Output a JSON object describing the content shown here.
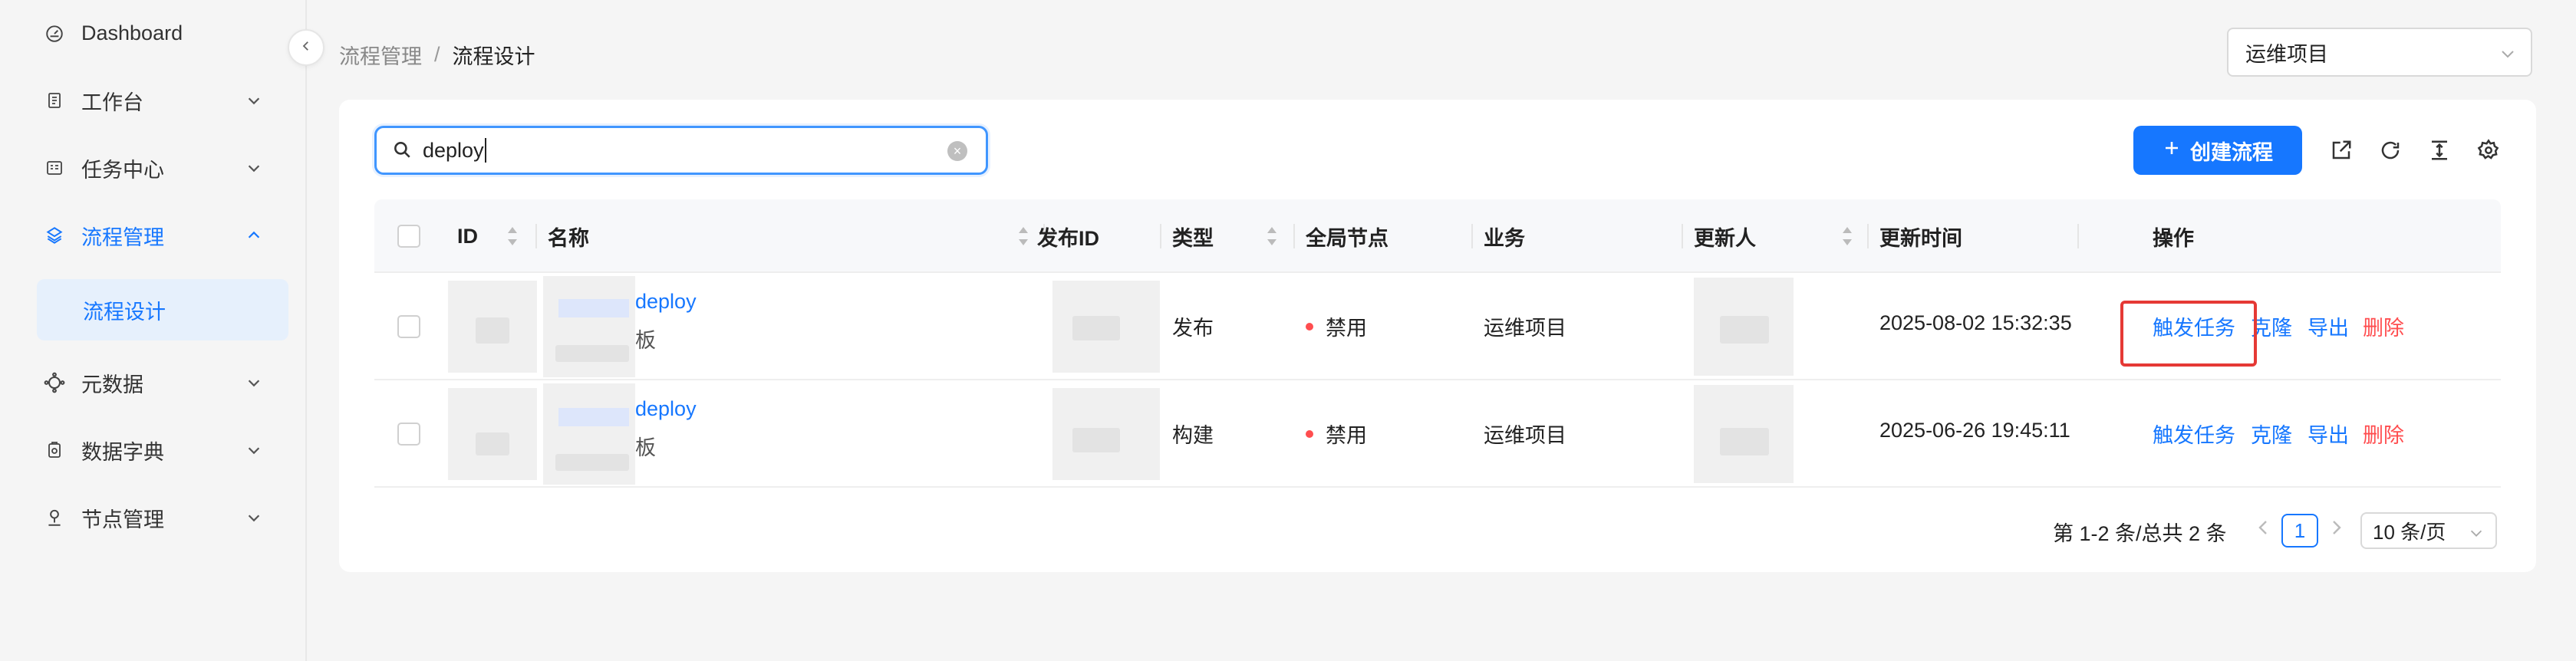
{
  "sidebar": {
    "items": [
      {
        "label": "Dashboard",
        "icon": "dashboard-icon"
      },
      {
        "label": "工作台",
        "icon": "workbench-icon"
      },
      {
        "label": "任务中心",
        "icon": "task-center-icon"
      },
      {
        "label": "流程管理",
        "icon": "flow-icon",
        "active": true
      },
      {
        "label": "元数据",
        "icon": "metadata-icon"
      },
      {
        "label": "数据字典",
        "icon": "dictionary-icon"
      },
      {
        "label": "节点管理",
        "icon": "node-icon"
      }
    ],
    "submenu_label": "流程设计"
  },
  "header": {
    "breadcrumb": [
      "流程管理",
      "/",
      "流程设计"
    ],
    "project_select": "运维项目"
  },
  "toolbar": {
    "search_value": "deploy",
    "create_label": "创建流程"
  },
  "table": {
    "columns": [
      "ID",
      "名称",
      "发布ID",
      "类型",
      "全局节点",
      "业务",
      "更新人",
      "更新时间",
      "操作"
    ],
    "rows": [
      {
        "name": "deploy",
        "name_sub": "板",
        "type": "发布",
        "global_node": "禁用",
        "business": "运维项目",
        "updated_at": "2025-08-02 15:32:35",
        "actions": [
          "触发任务",
          "克隆",
          "导出",
          "删除"
        ]
      },
      {
        "name": "deploy",
        "name_sub": "板",
        "type": "构建",
        "global_node": "禁用",
        "business": "运维项目",
        "updated_at": "2025-06-26 19:45:11",
        "actions": [
          "触发任务",
          "克隆",
          "导出",
          "删除"
        ]
      }
    ]
  },
  "pagination": {
    "summary": "第 1-2 条/总共 2 条",
    "current": "1",
    "page_size": "10 条/页"
  },
  "colors": {
    "accent": "#1677ff",
    "danger": "#ff4d4f",
    "highlight": "#e53935"
  }
}
